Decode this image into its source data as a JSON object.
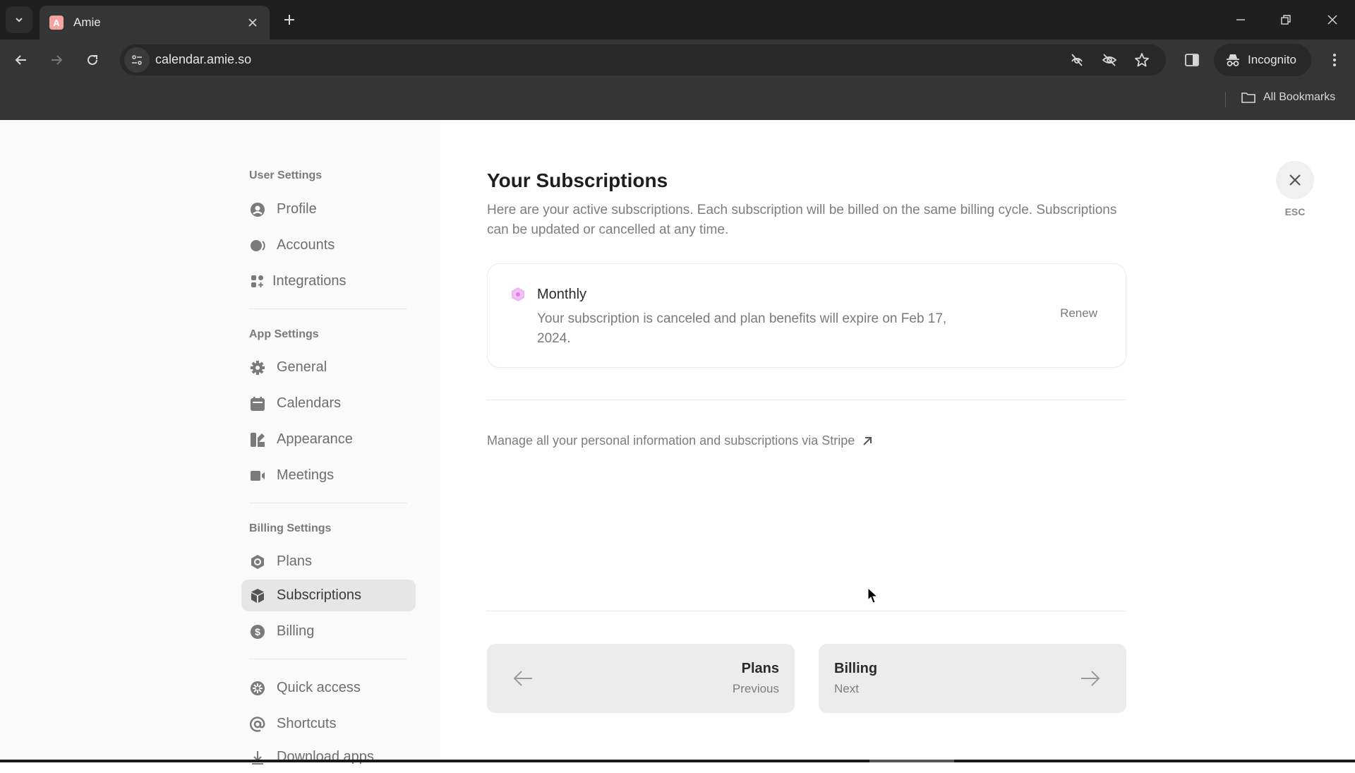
{
  "browser": {
    "tab": {
      "title": "Amie",
      "favicon_letter": "A"
    },
    "url": "calendar.amie.so",
    "incognito_label": "Incognito",
    "bookmarks_label": "All Bookmarks",
    "icons": {
      "tab_search": "chevron-down-icon",
      "new_tab": "plus-icon",
      "back": "arrow-left-icon",
      "forward": "arrow-right-icon",
      "reload": "reload-icon",
      "site_info": "tune-icon",
      "tracking": "eye-off-icon",
      "bookmark": "star-icon",
      "side_panel": "side-panel-icon",
      "menu": "kebab-menu-icon"
    }
  },
  "sidebar": {
    "sections": [
      {
        "title": "User Settings",
        "items": [
          {
            "label": "Profile",
            "icon": "user-circle-icon"
          },
          {
            "label": "Accounts",
            "icon": "accounts-icon"
          },
          {
            "label": "Integrations",
            "icon": "integrations-icon"
          }
        ]
      },
      {
        "title": "App Settings",
        "items": [
          {
            "label": "General",
            "icon": "gear-icon"
          },
          {
            "label": "Calendars",
            "icon": "calendar-icon"
          },
          {
            "label": "Appearance",
            "icon": "appearance-icon"
          },
          {
            "label": "Meetings",
            "icon": "video-icon"
          }
        ]
      },
      {
        "title": "Billing Settings",
        "items": [
          {
            "label": "Plans",
            "icon": "hexagon-icon"
          },
          {
            "label": "Subscriptions",
            "icon": "box-icon",
            "active": true
          },
          {
            "label": "Billing",
            "icon": "dollar-icon"
          }
        ]
      },
      {
        "title": "",
        "items": [
          {
            "label": "Quick access",
            "icon": "quick-access-icon"
          },
          {
            "label": "Shortcuts",
            "icon": "at-icon"
          },
          {
            "label": "Download apps",
            "icon": "download-icon"
          }
        ]
      }
    ]
  },
  "main": {
    "title": "Your Subscriptions",
    "description": "Here are your active subscriptions. Each subscription will be billed on the same billing cycle. Subscriptions can be updated or cancelled at any time.",
    "subscription": {
      "name": "Monthly",
      "status": "Your subscription is canceled and plan benefits will expire on Feb 17, 2024.",
      "action_label": "Renew",
      "accent_color": "#e27be8"
    },
    "stripe_link": "Manage all your personal information and subscriptions via Stripe",
    "pager": {
      "prev": {
        "title": "Plans",
        "sub": "Previous"
      },
      "next": {
        "title": "Billing",
        "sub": "Next"
      }
    },
    "close_label": "ESC"
  }
}
